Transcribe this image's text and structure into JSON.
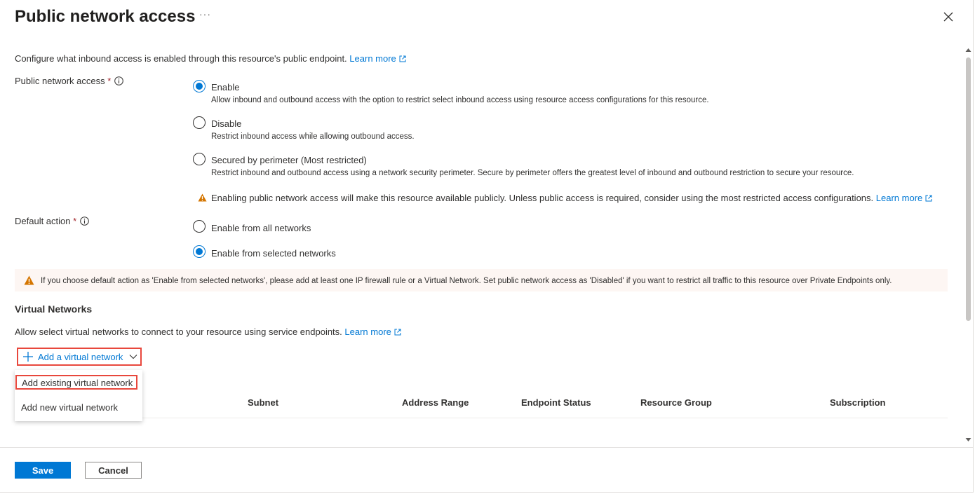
{
  "header": {
    "title": "Public network access",
    "more_label": "···"
  },
  "description": {
    "text": "Configure what inbound access is enabled through this resource's public endpoint.",
    "link": "Learn more"
  },
  "public_access": {
    "label": "Public network access",
    "required_mark": "*",
    "options": [
      {
        "label": "Enable",
        "description": "Allow inbound and outbound access with the option to restrict select inbound access using resource access configurations for this resource.",
        "selected": true
      },
      {
        "label": "Disable",
        "description": "Restrict inbound access while allowing outbound access.",
        "selected": false
      },
      {
        "label": "Secured by perimeter (Most restricted)",
        "description": "Restrict inbound and outbound access using a network security perimeter. Secure by perimeter offers the greatest level of inbound and outbound restriction to secure your resource.",
        "selected": false
      }
    ],
    "warning": "Enabling public network access will make this resource available publicly. Unless public access is required, consider using the most restricted access configurations.",
    "warning_link": "Learn more"
  },
  "default_action": {
    "label": "Default action",
    "required_mark": "*",
    "options": [
      {
        "label": "Enable from all networks",
        "selected": false
      },
      {
        "label": "Enable from selected networks",
        "selected": true
      }
    ]
  },
  "notice": {
    "text": "If you choose default action as 'Enable from selected networks', please add at least one IP firewall rule or a Virtual Network. Set public network access as 'Disabled' if you want to restrict all traffic to this resource over Private Endpoints only."
  },
  "virtual_networks": {
    "heading": "Virtual Networks",
    "description": "Allow select virtual networks to connect to your resource using service endpoints.",
    "link": "Learn more",
    "add_button": "Add a virtual network",
    "menu": [
      {
        "label": "Add existing virtual network"
      },
      {
        "label": "Add new virtual network"
      }
    ],
    "columns": [
      "Subnet",
      "Address Range",
      "Endpoint Status",
      "Resource Group",
      "Subscription"
    ]
  },
  "footer": {
    "save_label": "Save",
    "cancel_label": "Cancel"
  },
  "colors": {
    "accent": "#0078d4",
    "warning": "#d47500",
    "highlight_border": "#e8473c"
  }
}
